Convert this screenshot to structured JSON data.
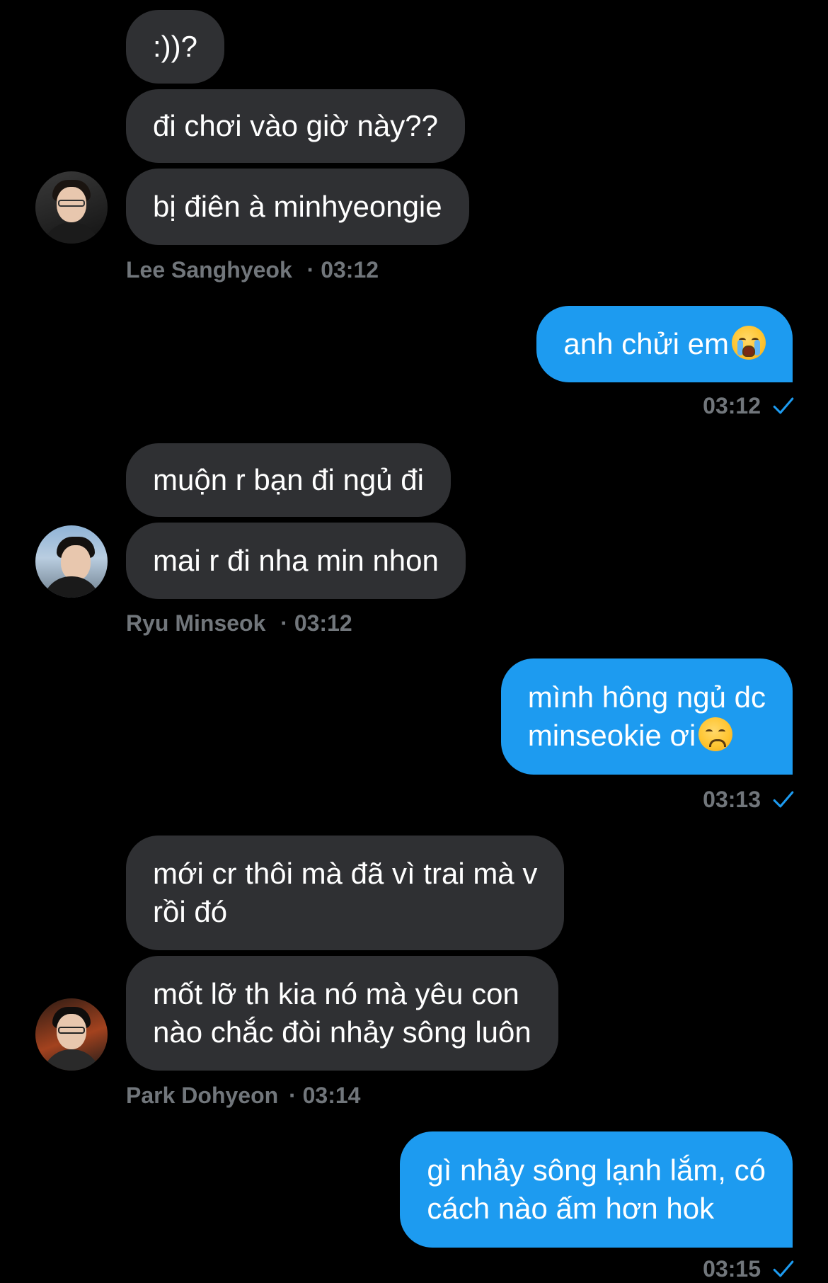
{
  "conversation": {
    "groups": [
      {
        "direction": "in",
        "sender": "Lee Sanghyeok",
        "time": "03:12",
        "messages": [
          ":))?",
          "đi chơi vào giờ này??",
          "bị điên à minhyeongie"
        ]
      },
      {
        "direction": "out",
        "time": "03:12",
        "messages": [
          {
            "text": "anh chửi em",
            "emoji": "loudly-crying-face-emoji"
          }
        ]
      },
      {
        "direction": "in",
        "sender": "Ryu Minseok",
        "time": "03:12",
        "messages": [
          "muộn r bạn đi ngủ đi",
          "mai r đi nha min nhon"
        ]
      },
      {
        "direction": "out",
        "time": "03:13",
        "messages": [
          {
            "line1": "mình hông ngủ dc",
            "line2": "minseokie ơi",
            "emoji": "disappointed-face-emoji"
          }
        ]
      },
      {
        "direction": "in",
        "sender": "Park Dohyeon",
        "time": "03:14",
        "messages": [
          {
            "line1": "mới cr thôi mà đã vì trai mà v",
            "line2": "rồi đó"
          },
          {
            "line1": "mốt lỡ th kia nó mà yêu con",
            "line2": "nào chắc đòi nhảy sông luôn"
          }
        ]
      },
      {
        "direction": "out",
        "time": "03:15",
        "messages": [
          {
            "line1": "gì nhảy sông lạnh lắm, có",
            "line2": "cách nào ấm hơn hok"
          }
        ]
      }
    ]
  },
  "meta_separator": "·",
  "colors": {
    "background": "#000000",
    "incoming_bubble": "#2f3033",
    "outgoing_bubble": "#1d9bf0",
    "meta_text": "#71767b",
    "read_check": "#1d9bf0"
  }
}
